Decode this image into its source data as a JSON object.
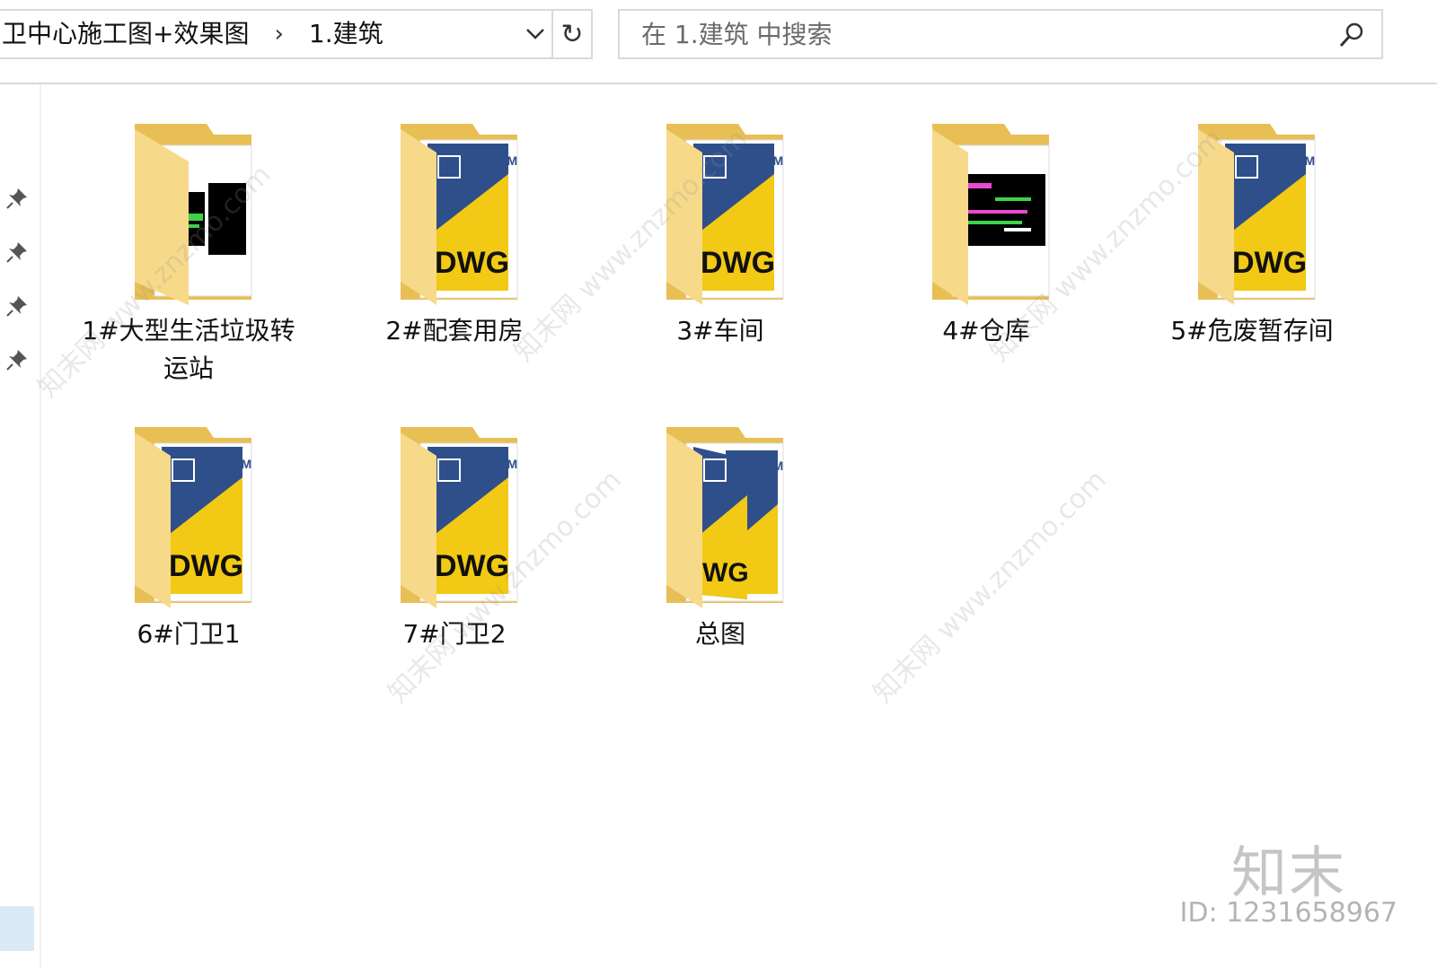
{
  "address": {
    "crumbs": [
      "卫中心施工图+效果图",
      "1.建筑"
    ],
    "separator": "›",
    "dropdown": "⌄",
    "refresh": "↻"
  },
  "search": {
    "placeholder": "在 1.建筑 中搜索"
  },
  "items": [
    {
      "label": "1#大型生活垃圾转运站",
      "thumb": "cad-dark"
    },
    {
      "label": "2#配套用房",
      "thumb": "dwg"
    },
    {
      "label": "3#车间",
      "thumb": "dwg"
    },
    {
      "label": "4#仓库",
      "thumb": "cad-color"
    },
    {
      "label": "5#危废暂存间",
      "thumb": "dwg"
    },
    {
      "label": "6#门卫1",
      "thumb": "dwg"
    },
    {
      "label": "7#门卫2",
      "thumb": "dwg"
    },
    {
      "label": "总图",
      "thumb": "dwg-multi"
    }
  ],
  "watermark": {
    "text": "知末网 www.znzmo.com",
    "logo": "知末",
    "id": "ID: 1231658967"
  },
  "colors": {
    "folder": "#f5d47a",
    "folder_dark": "#e8bf55",
    "dwg_blue": "#2f4f8a",
    "dwg_yellow": "#f2c914",
    "border": "#d9d9d9"
  }
}
